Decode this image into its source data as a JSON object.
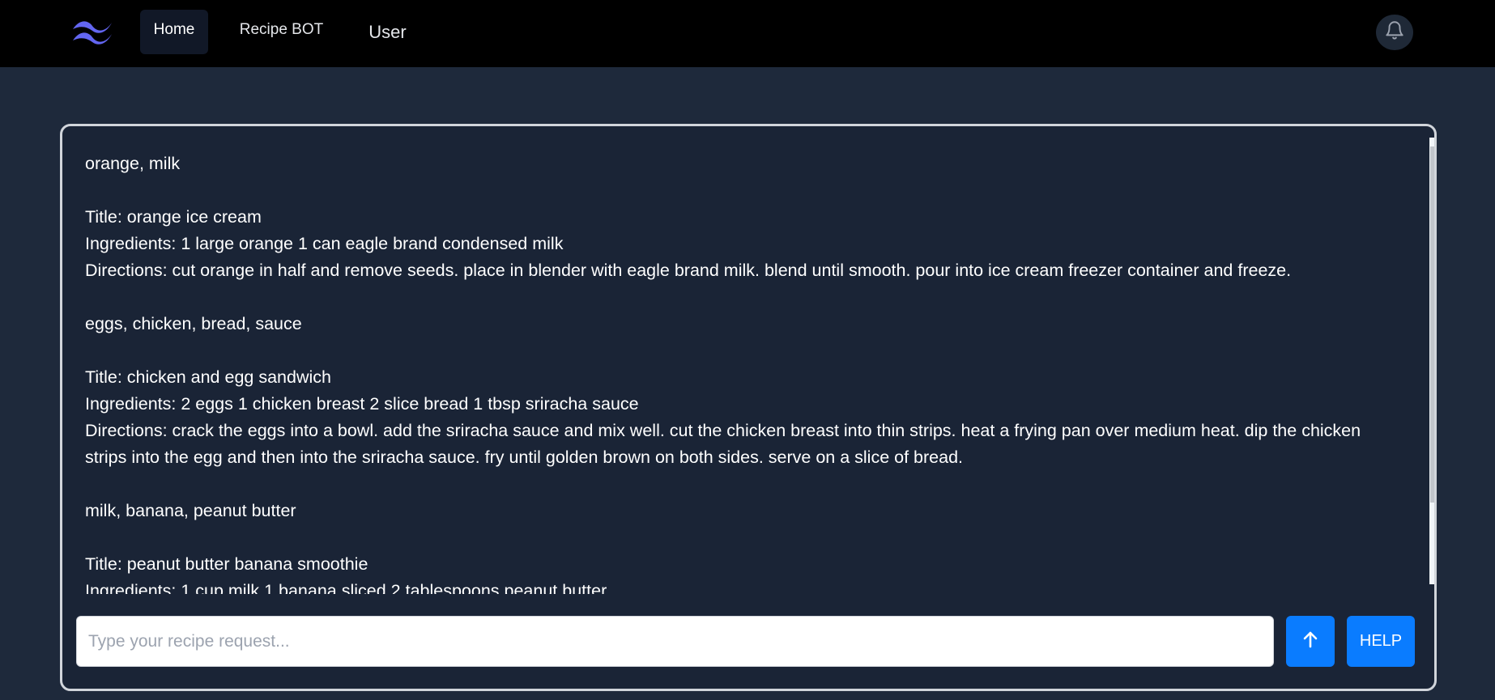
{
  "nav": {
    "items": [
      {
        "label": "Home",
        "active": true
      },
      {
        "label": "Recipe BOT",
        "active": false
      },
      {
        "label": "User",
        "active": false
      }
    ],
    "logo_icon": "tailwind-waves-logo",
    "notification_icon": "bell-icon"
  },
  "chat": {
    "messages": [
      {
        "lines": [
          "orange, milk"
        ]
      },
      {
        "lines": [
          "Title: orange ice cream",
          "Ingredients: 1 large orange 1 can eagle brand condensed milk",
          "Directions: cut orange in half and remove seeds. place in blender with eagle brand milk. blend until smooth. pour into ice cream freezer container and freeze."
        ]
      },
      {
        "lines": [
          "eggs, chicken, bread, sauce"
        ]
      },
      {
        "lines": [
          "Title: chicken and egg sandwich",
          "Ingredients: 2 eggs 1 chicken breast 2 slice bread 1 tbsp sriracha sauce",
          "Directions: crack the eggs into a bowl. add the sriracha sauce and mix well. cut the chicken breast into thin strips. heat a frying pan over medium heat. dip the chicken strips into the egg and then into the sriracha sauce. fry until golden brown on both sides. serve on a slice of bread."
        ]
      },
      {
        "lines": [
          "milk, banana, peanut butter"
        ]
      },
      {
        "lines": [
          "Title: peanut butter banana smoothie",
          "Ingredients: 1 cup milk 1 banana sliced 2 tablespoons peanut butter"
        ]
      }
    ]
  },
  "input": {
    "placeholder": "Type your recipe request...",
    "value": ""
  },
  "buttons": {
    "send_icon": "arrow-up-icon",
    "help_label": "HELP"
  },
  "colors": {
    "navbar_bg": "#000000",
    "page_bg": "#1e293b",
    "accent": "#0a7cff",
    "logo": "#6366f1"
  }
}
